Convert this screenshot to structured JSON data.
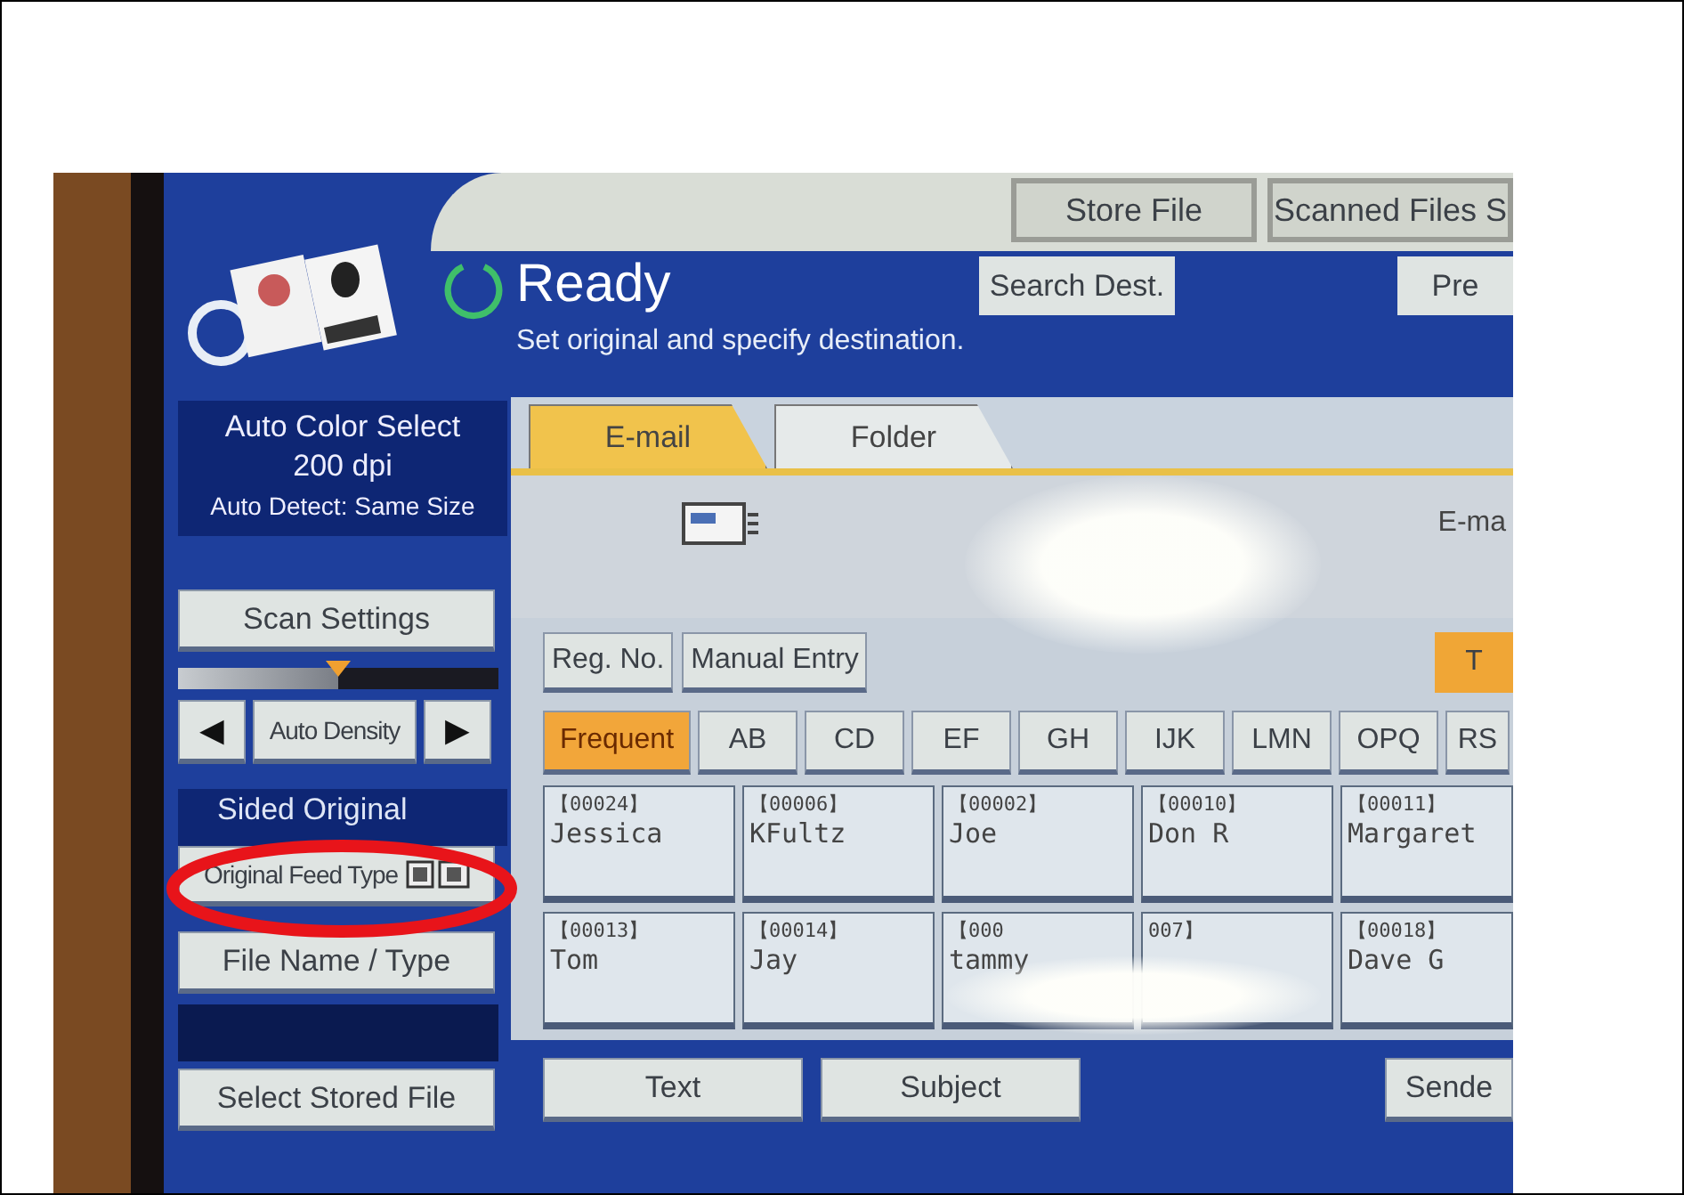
{
  "top_buttons": [
    "Store File",
    "Scanned Files S"
  ],
  "status": {
    "title": "Ready",
    "message": "Set original and specify destination."
  },
  "header_buttons": [
    "Search Dest.",
    "Pre"
  ],
  "scan_info": [
    "Auto Color Select",
    "200 dpi",
    "Auto Detect: Same Size"
  ],
  "scan_settings": "Scan Settings",
  "density": {
    "level": 0.5,
    "left": "◀",
    "label": "Auto Density",
    "right": "▶"
  },
  "sided_original": "Sided Original",
  "feed_type": "Original Feed Type",
  "file_name": "File Name / Type",
  "select_stored": "Select Stored File",
  "tabs": [
    {
      "label": "E-mail",
      "selected": true
    },
    {
      "label": "Folder",
      "selected": false
    }
  ],
  "destination_label": "E-ma",
  "entry_buttons": [
    "Reg. No.",
    "Manual Entry"
  ],
  "title_button": "T",
  "index_tabs": [
    {
      "label": "Frequent",
      "selected": true
    },
    {
      "label": "AB",
      "selected": false
    },
    {
      "label": "CD",
      "selected": false
    },
    {
      "label": "EF",
      "selected": false
    },
    {
      "label": "GH",
      "selected": false
    },
    {
      "label": "IJK",
      "selected": false
    },
    {
      "label": "LMN",
      "selected": false
    },
    {
      "label": "OPQ",
      "selected": false
    },
    {
      "label": "RS",
      "selected": false
    }
  ],
  "destinations": [
    {
      "code": "【00024】",
      "name": "Jessica"
    },
    {
      "code": "【00006】",
      "name": "KFultz"
    },
    {
      "code": "【00002】",
      "name": "Joe"
    },
    {
      "code": "【00010】",
      "name": "Don R"
    },
    {
      "code": "【00011】",
      "name": "Margaret"
    },
    {
      "code": "【00013】",
      "name": "Tom"
    },
    {
      "code": "【00014】",
      "name": "Jay"
    },
    {
      "code": "【000",
      "name": "tammy"
    },
    {
      "code": "007】"
    },
    {
      "code": "【00018】",
      "name": "Dave G"
    }
  ],
  "bottom_buttons": [
    "Text",
    "Subject",
    "Sende"
  ]
}
